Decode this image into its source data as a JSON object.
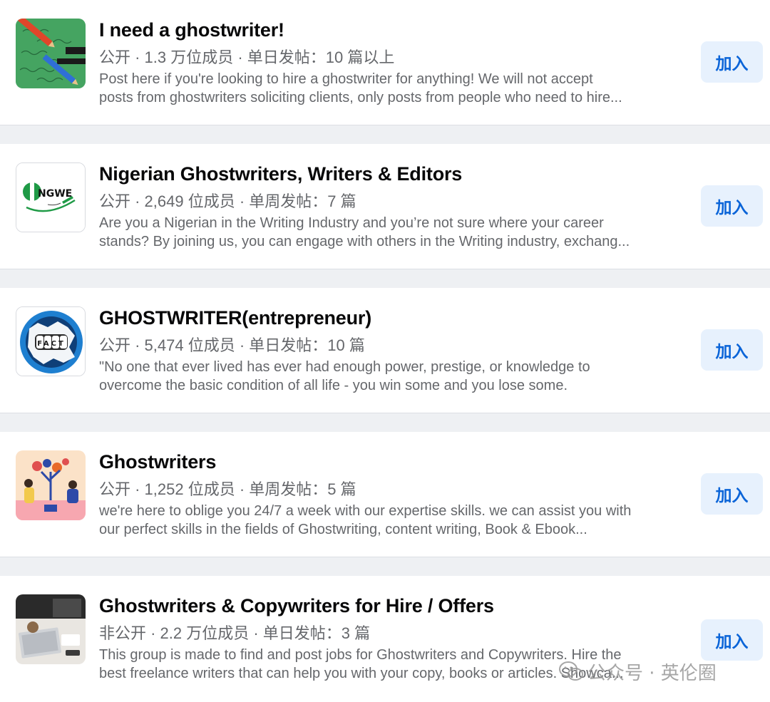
{
  "groups": [
    {
      "name": "I need a ghostwriter!",
      "meta": "公开 · 1.3 万位成员 · 单日发帖：10 篇以上",
      "desc_line1": "Post here if you're looking to hire a ghostwriter for anything! We will not accept",
      "desc_line2": "posts from ghostwriters soliciting clients, only posts from people who need to hire...",
      "join_label": "加入",
      "thumb_icon": "pencil-handwriting-image"
    },
    {
      "name": "Nigerian Ghostwriters, Writers & Editors",
      "meta": "公开 · 2,649 位成员 · 单周发帖：7 篇",
      "desc_line1": "Are you a Nigerian in the Writing Industry and you’re not sure where your career",
      "desc_line2": "stands? By joining us, you can engage with others in the Writing industry, exchang...",
      "join_label": "加入",
      "thumb_icon": "ngwe-logo",
      "logo_text": "NGWE"
    },
    {
      "name": "GHOSTWRITER(entrepreneur)",
      "meta": "公开 · 5,474 位成员 · 单日发帖：10 篇",
      "desc_line1": "\"No one that ever lived has ever had enough power, prestige, or knowledge to",
      "desc_line2": "overcome the basic condition of all life - you win some and you lose some.",
      "join_label": "加入",
      "thumb_icon": "fist-fact-image",
      "logo_text": "FACT"
    },
    {
      "name": "Ghostwriters",
      "meta": "公开 · 1,252 位成员 · 单周发帖：5 篇",
      "desc_line1": "we're here to oblige you 24/7 a week with our expertise skills. we can assist you with",
      "desc_line2": "our perfect skills in the fields of Ghostwriting, content writing, Book & Ebook...",
      "join_label": "加入",
      "thumb_icon": "people-plants-illustration"
    },
    {
      "name": "Ghostwriters & Copywriters for Hire / Offers",
      "meta": "非公开 · 2.2 万位成员 · 单日发帖：3 篇",
      "desc_line1": "This group is made to find and post jobs for Ghostwriters and Copywriters. Hire the",
      "desc_line2": "best freelance writers that can help you with your copy, books or articles. Showca...",
      "join_label": "加入",
      "thumb_icon": "laptop-desk-photo"
    }
  ],
  "watermark": {
    "text": "公众号 · 英伦圈",
    "icon": "wechat-icon"
  },
  "colors": {
    "join_bg": "#e7f1fd",
    "join_text": "#0a64d8",
    "separator_bg": "#eef0f3"
  }
}
